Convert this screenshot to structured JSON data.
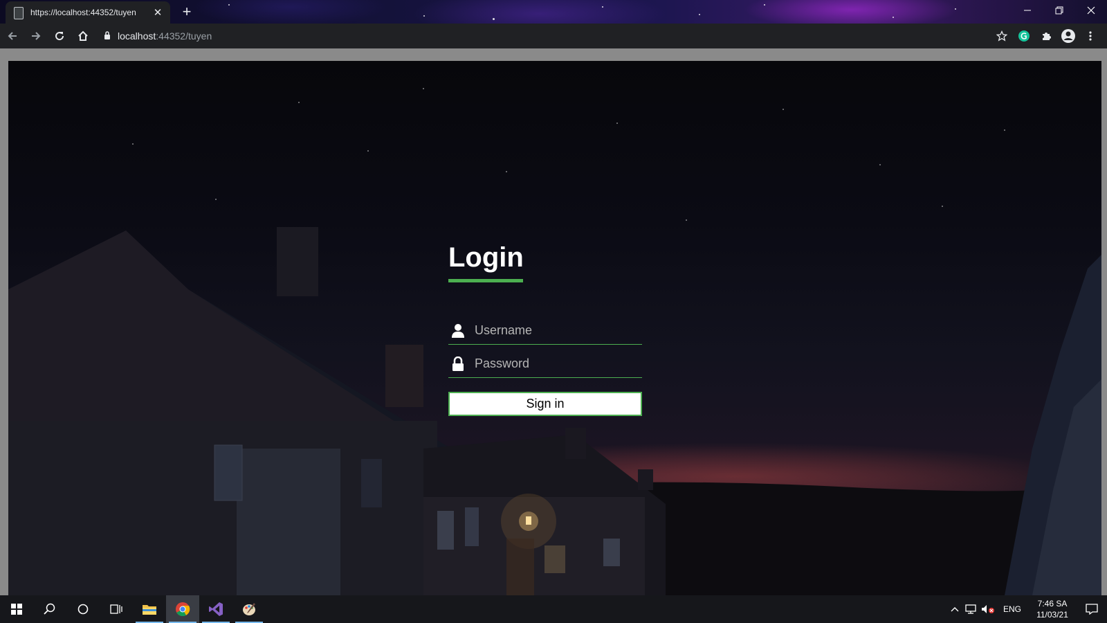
{
  "browser": {
    "tab_title": "https://localhost:44352/tuyen",
    "url_host": "localhost",
    "url_path": ":44352/tuyen"
  },
  "login": {
    "title": "Login",
    "username_placeholder": "Username",
    "password_placeholder": "Password",
    "signin_label": "Sign in",
    "accent_color": "#4caf50"
  },
  "taskbar": {
    "language": "ENG",
    "time": "7:46 SA",
    "date": "11/03/21"
  }
}
